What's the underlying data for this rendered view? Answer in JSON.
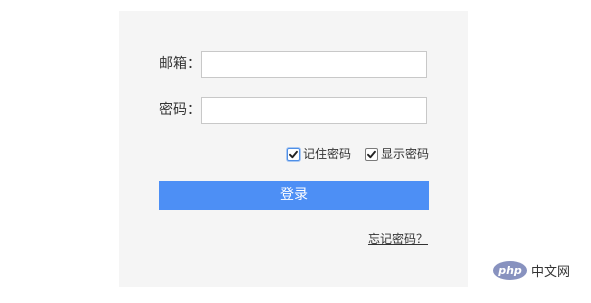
{
  "form": {
    "email_label": "邮箱：",
    "email_value": "",
    "password_label": "密码：",
    "password_value": "",
    "remember": {
      "label": "记住密码",
      "checked": true
    },
    "show_password": {
      "label": "显示密码",
      "checked": true
    },
    "login_label": "登录",
    "forgot_label": "忘记密码？"
  },
  "watermark": {
    "logo_text": "php",
    "site_name": "中文网"
  }
}
